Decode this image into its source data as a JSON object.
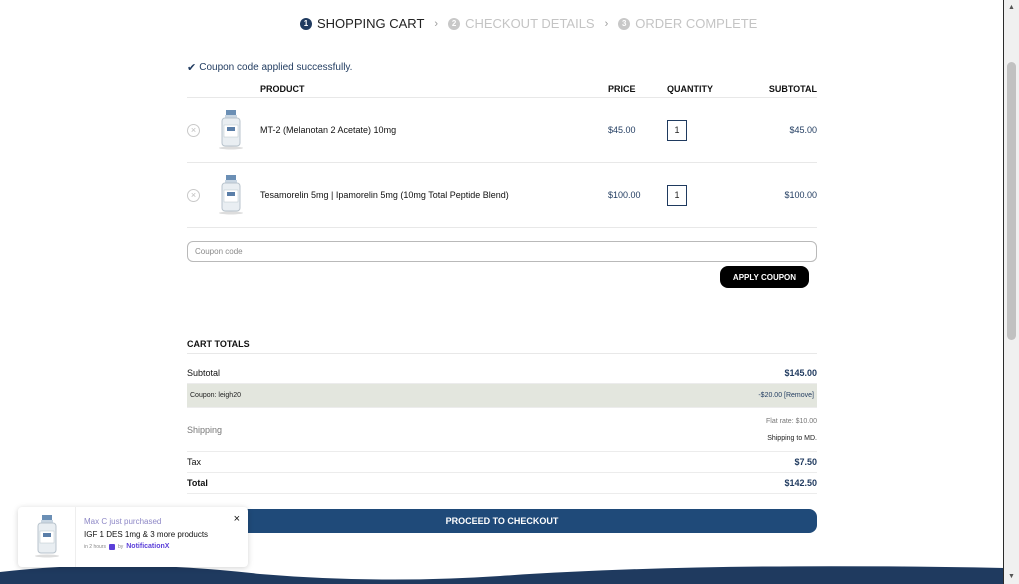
{
  "steps": [
    {
      "num": "1",
      "label": "SHOPPING CART"
    },
    {
      "num": "2",
      "label": "CHECKOUT DETAILS"
    },
    {
      "num": "3",
      "label": "ORDER COMPLETE"
    }
  ],
  "notice": "Coupon code applied successfully.",
  "cart": {
    "headers": {
      "product": "PRODUCT",
      "price": "PRICE",
      "quantity": "QUANTITY",
      "subtotal": "SUBTOTAL"
    },
    "items": [
      {
        "name": "MT-2 (Melanotan 2 Acetate) 10mg",
        "price": "$45.00",
        "quantity": "1",
        "subtotal": "$45.00"
      },
      {
        "name": "Tesamorelin 5mg | Ipamorelin 5mg (10mg Total Peptide Blend)",
        "price": "$100.00",
        "quantity": "1",
        "subtotal": "$100.00"
      }
    ]
  },
  "coupon": {
    "placeholder": "Coupon code",
    "apply_label": "APPLY COUPON"
  },
  "totals": {
    "title": "CART TOTALS",
    "subtotal_label": "Subtotal",
    "subtotal_value": "$145.00",
    "coupon_label": "Coupon: leigh20",
    "coupon_value": "-$20.00 [Remove]",
    "shipping_label": "Shipping",
    "shipping_rate": "Flat rate: $10.00",
    "shipping_to": "Shipping to MD.",
    "tax_label": "Tax",
    "tax_value": "$7.50",
    "total_label": "Total",
    "total_value": "$142.50"
  },
  "checkout_label": "PROCEED TO CHECKOUT",
  "notification": {
    "who": "Max C just purchased",
    "what": "IGF 1 DES 1mg & 3 more products",
    "time": "in 2 hours",
    "by": "by",
    "brand": "NotificationX",
    "close": "×"
  },
  "colors": {
    "accent": "#1f3a5f",
    "button": "#1f4a79",
    "coupon_row": "#e3e6de"
  }
}
